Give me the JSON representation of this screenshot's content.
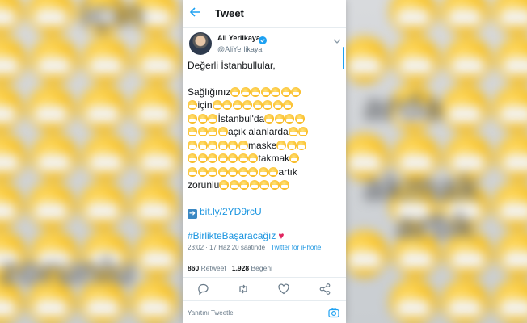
{
  "header": {
    "title": "Tweet"
  },
  "author": {
    "name": "Ali Yerlikaya",
    "handle": "@AliYerlikaya"
  },
  "tweet": {
    "greeting": "Değerli İstanbullular,",
    "lines": [
      [
        {
          "t": "Sağlığınız"
        },
        {
          "e": 7
        }
      ],
      [
        {
          "e": 1
        },
        {
          "t": "için"
        },
        {
          "e": 8
        }
      ],
      [
        {
          "e": 3
        },
        {
          "t": "İstanbul'da"
        },
        {
          "e": 4
        }
      ],
      [
        {
          "e": 4
        },
        {
          "t": "açık alanlarda"
        },
        {
          "e": 2
        }
      ],
      [
        {
          "e": 6
        },
        {
          "t": "maske"
        },
        {
          "e": 3
        }
      ],
      [
        {
          "e": 7
        },
        {
          "t": "takmak"
        },
        {
          "e": 1
        }
      ],
      [
        {
          "e": 9
        },
        {
          "t": "artık"
        }
      ],
      [
        {
          "t": "zorunlu"
        },
        {
          "e": 7
        }
      ]
    ],
    "link": "bit.ly/2YD9rcU",
    "hashtag": "#BirlikteBaşaracağız",
    "heart": "♥",
    "mask_emoji": "face-with-medical-mask"
  },
  "meta": {
    "time": "23:02 · 17 Haz 20 saatinde · ",
    "client": "Twitter for iPhone"
  },
  "stats": {
    "retweets": "860",
    "retweets_label": "Retweet",
    "likes": "1.928",
    "likes_label": "Beğeni"
  },
  "reply": {
    "placeholder": "Yanıtını Tweetle"
  },
  "background_words": [
    "için",
    "arda",
    "akmak",
    "artık",
    "zorunlu"
  ],
  "colors": {
    "accent": "#1da1f2",
    "link": "#1b95e0",
    "heart": "#e0245e",
    "emoji": "#fbc02d"
  }
}
